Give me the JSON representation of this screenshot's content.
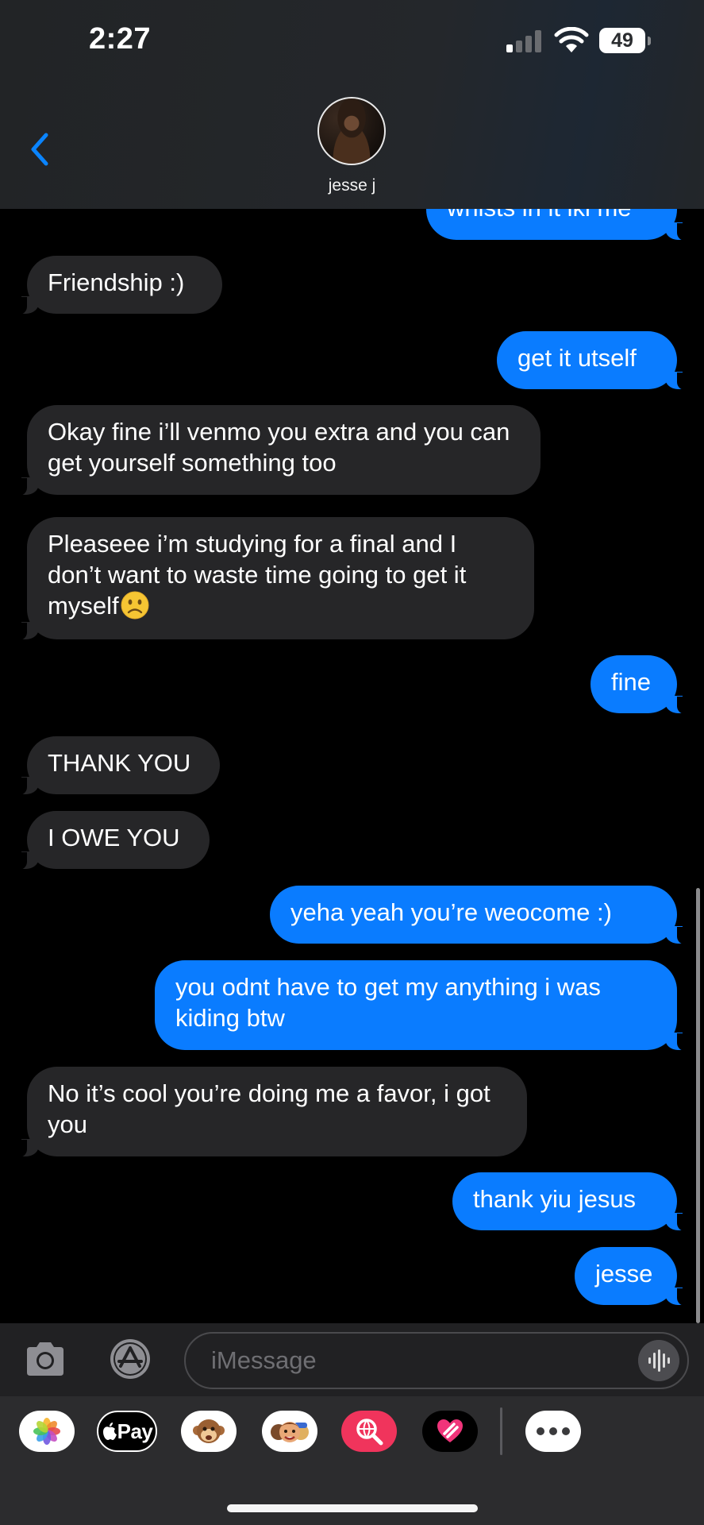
{
  "status_bar": {
    "time": "2:27",
    "battery_level": "49",
    "signal_bars_active": 1
  },
  "conversation": {
    "contact_name": "jesse j"
  },
  "messages": [
    {
      "direction": "out",
      "text": "whists in it iki me",
      "partially_hidden": true
    },
    {
      "direction": "in",
      "text": "Friendship :)"
    },
    {
      "direction": "out",
      "text": "get it utself"
    },
    {
      "direction": "in",
      "text": "Okay fine i’ll venmo you extra and you can get yourself something too"
    },
    {
      "direction": "in",
      "text": "Pleaseee i’m studying for a final and I don’t want to waste time going to get it myself",
      "emoji": "slightly-frowning-face"
    },
    {
      "direction": "out",
      "text": "fine"
    },
    {
      "direction": "in",
      "text": "THANK YOU"
    },
    {
      "direction": "in",
      "text": "I OWE YOU"
    },
    {
      "direction": "out",
      "text": "yeha yeah you’re weocome :)"
    },
    {
      "direction": "out",
      "text": "you odnt have to get my anything i was kiding btw"
    },
    {
      "direction": "in",
      "text": "No it’s cool you’re doing me a favor, i got you"
    },
    {
      "direction": "out",
      "text": "thank yiu jesus"
    },
    {
      "direction": "out",
      "text": "jesse"
    }
  ],
  "input_bar": {
    "placeholder": "iMessage"
  },
  "app_drawer": {
    "apps": [
      "photos-icon",
      "apple-pay-icon",
      "monkey-memoji-icon",
      "memoji-stickers-icon",
      "image-search-icon",
      "digital-touch-icon",
      "more-apps-icon"
    ],
    "apple_pay_label": "Pay"
  },
  "colors": {
    "outgoing_bubble": "#0a7cff",
    "incoming_bubble": "#262628",
    "background": "#000000",
    "accent": "#0a84ff"
  }
}
